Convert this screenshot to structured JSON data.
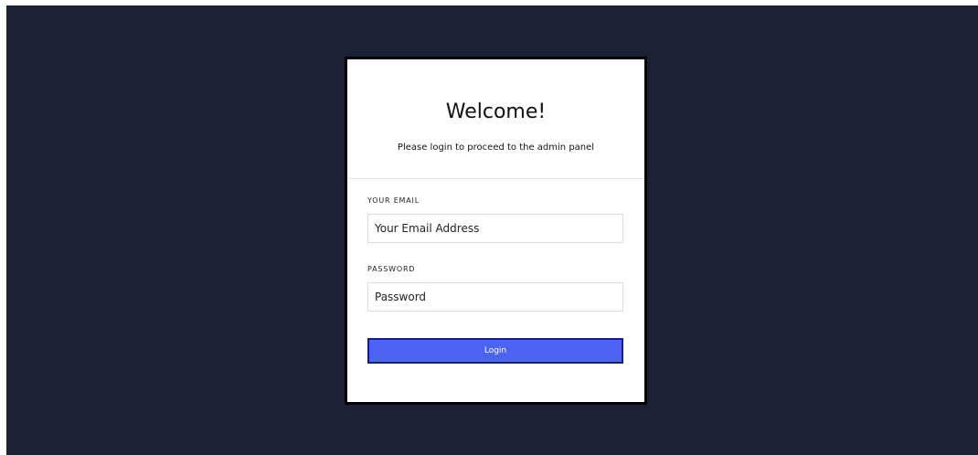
{
  "colors": {
    "page_background": "#1b2035",
    "card_background": "#ffffff",
    "button_background": "#4c63f2",
    "button_border": "#16207a"
  },
  "login": {
    "title": "Welcome!",
    "subtitle": "Please login to proceed to the admin panel",
    "email_label": "YOUR EMAIL",
    "email_placeholder": "Your Email Address",
    "email_value": "",
    "password_label": "PASSWORD",
    "password_placeholder": "Password",
    "password_value": "",
    "button_label": "Login"
  }
}
